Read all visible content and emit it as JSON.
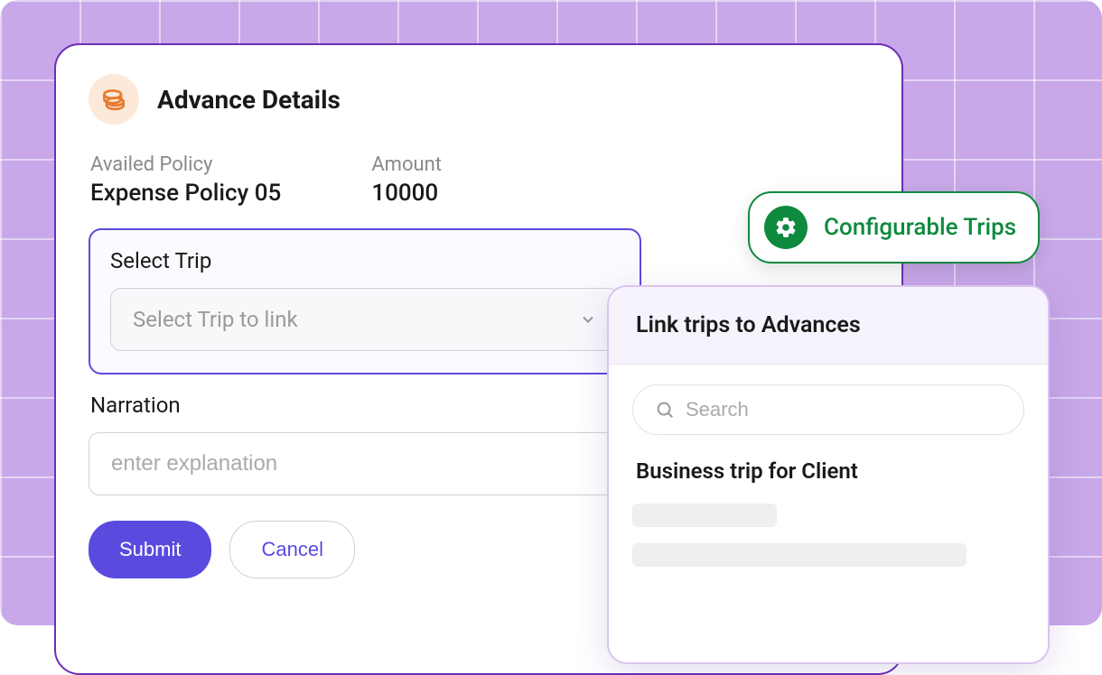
{
  "card": {
    "title": "Advance Details",
    "policy_label": "Availed Policy",
    "policy_value": "Expense Policy 05",
    "amount_label": "Amount",
    "amount_value": "10000",
    "select_trip_label": "Select Trip",
    "select_trip_placeholder": "Select Trip to link",
    "narration_label": "Narration",
    "narration_placeholder": "enter explanation",
    "submit_label": "Submit",
    "cancel_label": "Cancel"
  },
  "badge": {
    "text": "Configurable Trips"
  },
  "panel": {
    "title": "Link trips to Advances",
    "search_placeholder": "Search",
    "trip_item": "Business trip for Client"
  }
}
